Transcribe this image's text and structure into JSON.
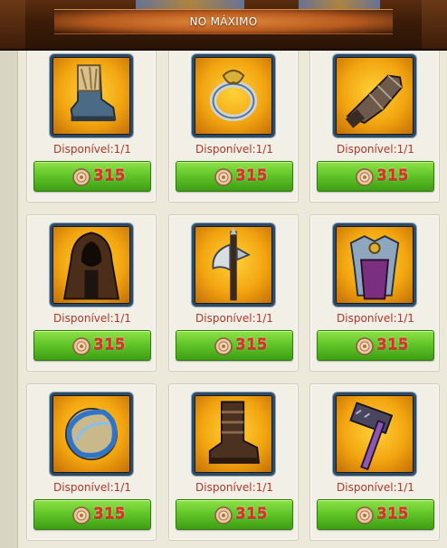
{
  "banner": {
    "text": "NO MÁXIMO"
  },
  "currency": {
    "icon": "rune-coin-icon"
  },
  "items": [
    {
      "name": "boot-item",
      "availability": "Disponível:1/1",
      "price": "315",
      "icon": "fur-boot-icon"
    },
    {
      "name": "ring-item",
      "availability": "Disponível:1/1",
      "price": "315",
      "icon": "ring-icon"
    },
    {
      "name": "gauntlet-item",
      "availability": "Disponível:1/1",
      "price": "315",
      "icon": "gauntlet-icon"
    },
    {
      "name": "hood-item",
      "availability": "Disponível:1/1",
      "price": "315",
      "icon": "hooded-cloak-icon"
    },
    {
      "name": "axe-item",
      "availability": "Disponível:1/1",
      "price": "315",
      "icon": "halberd-axe-icon"
    },
    {
      "name": "armor-item",
      "availability": "Disponível:1/1",
      "price": "315",
      "icon": "chest-armor-icon"
    },
    {
      "name": "orb-item",
      "availability": "Disponível:1/1",
      "price": "315",
      "icon": "blue-orb-icon"
    },
    {
      "name": "leather-boot-item",
      "availability": "Disponível:1/1",
      "price": "315",
      "icon": "leather-boot-icon"
    },
    {
      "name": "hammer-item",
      "availability": "Disponível:1/1",
      "price": "315",
      "icon": "war-hammer-icon"
    }
  ]
}
